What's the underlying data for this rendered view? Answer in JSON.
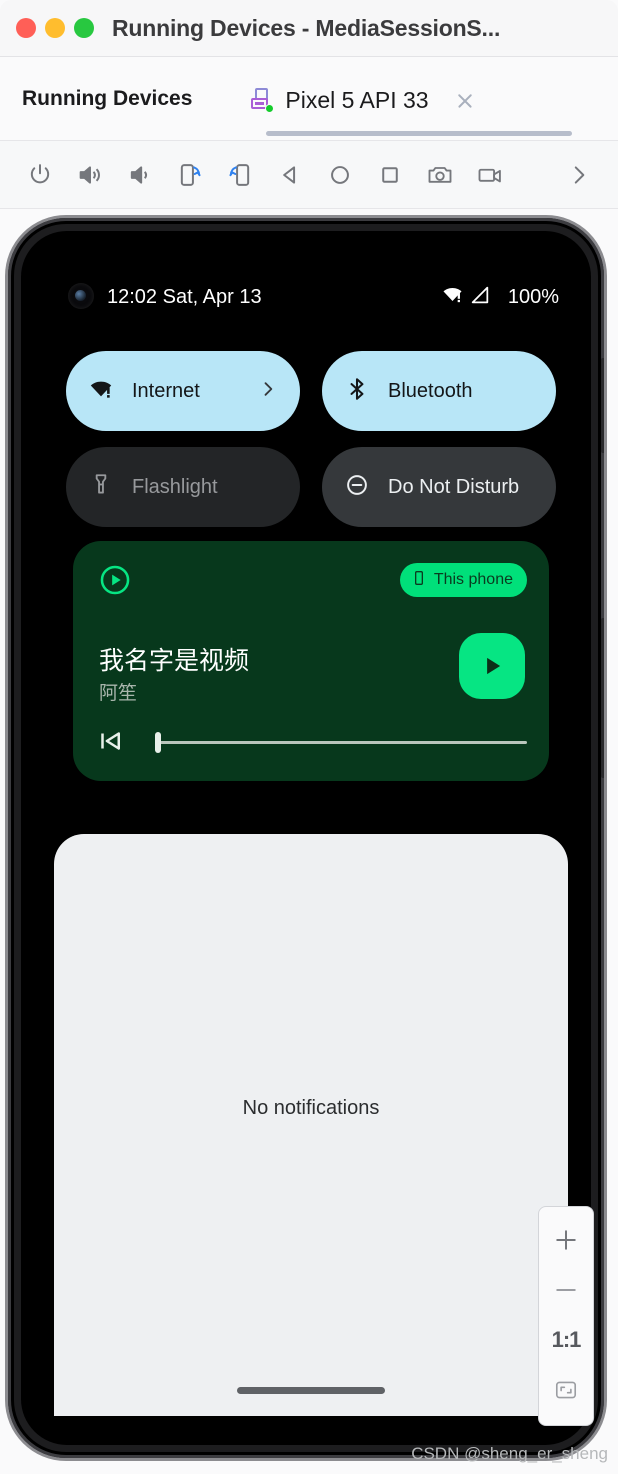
{
  "window": {
    "title": "Running Devices - MediaSessionS...",
    "traffic_lights": [
      "close",
      "minimize",
      "zoom"
    ]
  },
  "tool_window": {
    "title": "Running Devices",
    "tab": {
      "label": "Pixel 5 API 33",
      "icon": "device-icon",
      "status": "running",
      "close_label": "×"
    }
  },
  "toolbar": {
    "buttons": [
      {
        "name": "power-button",
        "icon": "power-icon"
      },
      {
        "name": "volume-up-button",
        "icon": "volume-up-icon"
      },
      {
        "name": "volume-down-button",
        "icon": "volume-down-icon"
      },
      {
        "name": "rotate-right-button",
        "icon": "rotate-right-icon"
      },
      {
        "name": "rotate-left-button",
        "icon": "rotate-left-icon"
      },
      {
        "name": "back-button",
        "icon": "back-triangle-icon"
      },
      {
        "name": "home-button",
        "icon": "home-circle-icon"
      },
      {
        "name": "overview-button",
        "icon": "overview-square-icon"
      },
      {
        "name": "screenshot-button",
        "icon": "camera-icon"
      },
      {
        "name": "record-button",
        "icon": "video-camera-icon"
      },
      {
        "name": "more-button",
        "icon": "chevron-right-icon"
      }
    ]
  },
  "device_screen": {
    "status_bar": {
      "time": "12:02 Sat, Apr 13",
      "wifi_icon": "wifi-alert-icon",
      "signal_icon": "cell-signal-icon",
      "battery": "100%"
    },
    "quick_settings": [
      {
        "label": "Internet",
        "state": "on",
        "icon": "wifi-alert-icon",
        "has_chevron": true
      },
      {
        "label": "Bluetooth",
        "state": "on",
        "icon": "bluetooth-icon",
        "has_chevron": false
      },
      {
        "label": "Flashlight",
        "state": "off",
        "icon": "flashlight-icon",
        "has_chevron": false
      },
      {
        "label": "Do Not Disturb",
        "state": "inactive",
        "icon": "do-not-disturb-icon",
        "has_chevron": false
      }
    ],
    "media_player": {
      "app_icon": "play-circle-outline-icon",
      "output_chip": {
        "label": "This phone",
        "icon": "phone-icon"
      },
      "title": "我名字是视频",
      "artist": "阿笙",
      "play_icon": "play-icon",
      "prev_icon": "skip-previous-icon",
      "progress_percent": 0
    },
    "notification_shade": {
      "empty_text": "No notifications"
    }
  },
  "zoom_controls": {
    "zoom_in": "+",
    "zoom_out": "−",
    "actual_size": "1:1",
    "fit_to_screen": "fit-icon"
  },
  "watermark": "CSDN @sheng_er_sheng",
  "colors": {
    "tile_active": "#b8e6f7",
    "tile_inactive": "#232527",
    "tile_dnd": "#35383b",
    "media_bg": "#07381c",
    "media_accent": "#06e583",
    "shade_bg": "#eef0f2",
    "tab_indicator": "#b7bdcb"
  }
}
